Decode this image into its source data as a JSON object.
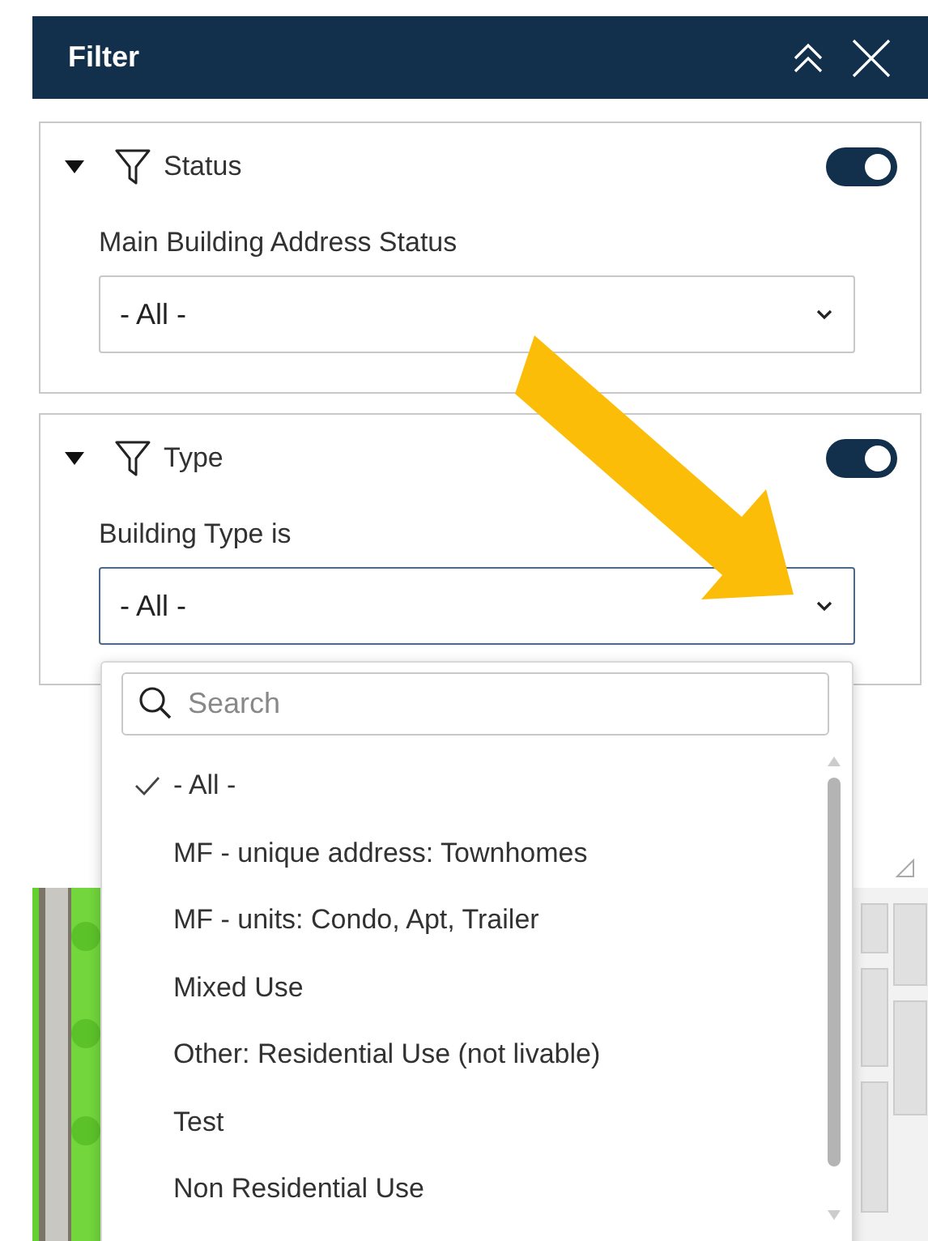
{
  "header": {
    "title": "Filter"
  },
  "filters": [
    {
      "title": "Status",
      "expanded": true,
      "on": true,
      "label": "Main Building Address Status",
      "value": "- All -",
      "open": false
    },
    {
      "title": "Type",
      "expanded": true,
      "on": true,
      "label": "Building Type is",
      "value": "- All -",
      "open": true
    }
  ],
  "dropdown": {
    "search": {
      "placeholder": "Search"
    },
    "options": [
      {
        "label": "- All -",
        "selected": true
      },
      {
        "label": "MF - unique address: Townhomes",
        "selected": false
      },
      {
        "label": "MF - units: Condo, Apt, Trailer",
        "selected": false
      },
      {
        "label": "Mixed Use",
        "selected": false
      },
      {
        "label": "Other: Residential Use (not livable)",
        "selected": false
      },
      {
        "label": "Test",
        "selected": false
      },
      {
        "label": "Non Residential Use",
        "selected": false
      }
    ]
  }
}
